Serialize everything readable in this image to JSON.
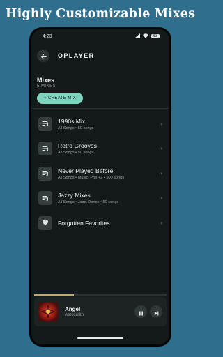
{
  "promo": {
    "title": "Highly Customizable Mixes"
  },
  "status": {
    "time": "4:23",
    "battery": "53"
  },
  "app": {
    "title": "OPLAYER"
  },
  "section": {
    "title": "Mixes",
    "subtitle": "5 MIXES",
    "create_label": "+ CREATE MIX"
  },
  "mixes": [
    {
      "name": "1990s Mix",
      "meta": "All Songs • 50 songs",
      "icon": "playlist-icon"
    },
    {
      "name": "Retro Grooves",
      "meta": "All Songs • 50 songs",
      "icon": "playlist-icon"
    },
    {
      "name": "Never Played Before",
      "meta": "All Songs • Music, Pop +2 • 500 songs",
      "icon": "playlist-icon"
    },
    {
      "name": "Jazzy Mixes",
      "meta": "All Songs • Jazz, Dance • 50 songs",
      "icon": "playlist-icon"
    },
    {
      "name": "Forgotten Favorites",
      "meta": "",
      "icon": "heart-icon"
    }
  ],
  "player": {
    "title": "Angel",
    "artist": "Aerosmith",
    "progress": 0.3
  },
  "colors": {
    "background": "#2f6f8d",
    "accent": "#7fd3bf",
    "screen": "#141a1a",
    "progress": "#c9a86c"
  }
}
